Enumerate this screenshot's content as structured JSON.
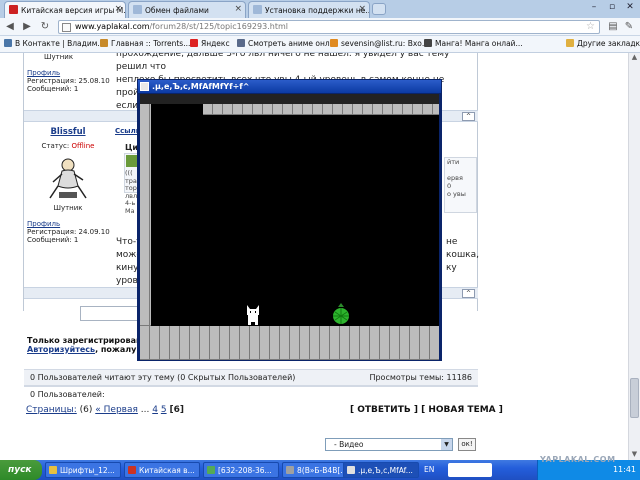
{
  "browser": {
    "tabs": [
      {
        "label": "Китайская версия игры М...",
        "icon_color": "#cc2222"
      },
      {
        "label": "Обмен файлами",
        "icon_color": "#9fb8d8"
      },
      {
        "label": "Установка поддержки не...",
        "icon_color": "#9fb8d8"
      }
    ],
    "url_host": "www.yaplakal.com",
    "url_path": "/forum28/st/125/topic169293.html",
    "bookmarks": [
      {
        "label": "В Контакте | Владим...",
        "icon_color": "#4a76a8"
      },
      {
        "label": "Главная :: Torrents....",
        "icon_color": "#c78a2a"
      },
      {
        "label": "Яндекс",
        "icon_color": "#dd2222"
      },
      {
        "label": "Смотреть аниме онл...",
        "icon_color": "#5a6a8a"
      },
      {
        "label": "sevensin@list.ru: Вхо...",
        "icon_color": "#e08a20"
      },
      {
        "label": "Манга! Манга онлай...",
        "icon_color": "#444444"
      },
      {
        "label": "Другие закладки",
        "icon_color": "#e0b040"
      }
    ]
  },
  "post1": {
    "username": "Шутник",
    "profile_label": "Профиль",
    "reg": "Регистрация: 25.08.10",
    "msgs": "Сообщений: 1",
    "text_line1": "прохождение, дальше 3-го лвл ничего не нашел. я увидел у вас тему решил что",
    "text_line2": "неплохо бы просветить всех что увы 4-ый уровень в самом конце не пройти((( а",
    "text_line3": "если"
  },
  "post2": {
    "author": "Blissful",
    "link_label": "Ссылк",
    "status_label": "Статус:",
    "status_value": "Offline",
    "username": "Шутник",
    "profile_label": "Профиль",
    "reg": "Регистрация: 24.09.10",
    "msgs": "Сообщений: 1",
    "quote_label": "Ци",
    "quote_right_lines": [
      "йти",
      "ервя",
      "0",
      "о увы"
    ],
    "quote_left_lines": [
      "(((",
      "тра",
      "торо",
      "лвл",
      "4-ь",
      "Ма"
    ],
    "text_left": [
      "Что-т",
      "може",
      "кинул",
      "уровн"
    ],
    "text_right": [
      "не",
      "кошка,",
      "ку"
    ]
  },
  "game": {
    "title": ".µ,e,Ъ,c,МfAfМfYf÷f^"
  },
  "forum": {
    "notice_line1": "Только зарегистрированн",
    "notice_line2_a": "Авторизуйтесь",
    "notice_line2_b": ", пожалуйс",
    "readers": "0 Пользователей читают эту тему (0 Скрытых Пользователей)",
    "views": "Просмотры темы: 11186",
    "users": "0 Пользователей:",
    "pages_label": "Страницы:",
    "pages_count": "(6)",
    "first": "« Первая",
    "ellipsis": "...",
    "page4": "4",
    "page5": "5",
    "page6": "[6]",
    "reply": "[ ОТВЕТИТЬ ]",
    "new_topic": "[ НОВАЯ ТЕМА ]",
    "select_value": "- Видео",
    "ok": "ок!"
  },
  "taskbar": {
    "start": "пуск",
    "items": [
      {
        "label": "Шрифты_12...",
        "icon_color": "#e8c040"
      },
      {
        "label": "Китайская в...",
        "icon_color": "#cc3322"
      },
      {
        "label": "[632-208-36...",
        "icon_color": "#55aa55"
      },
      {
        "label": "8(В»Б-В4В[...",
        "icon_color": "#a0a0a0"
      },
      {
        "label": ".µ,e,Ъ,c,МfAf...",
        "icon_color": "#e0e0e0"
      }
    ],
    "lang": "EN",
    "clock": "11:41",
    "watermark": "YAPLAKAL.COM"
  }
}
